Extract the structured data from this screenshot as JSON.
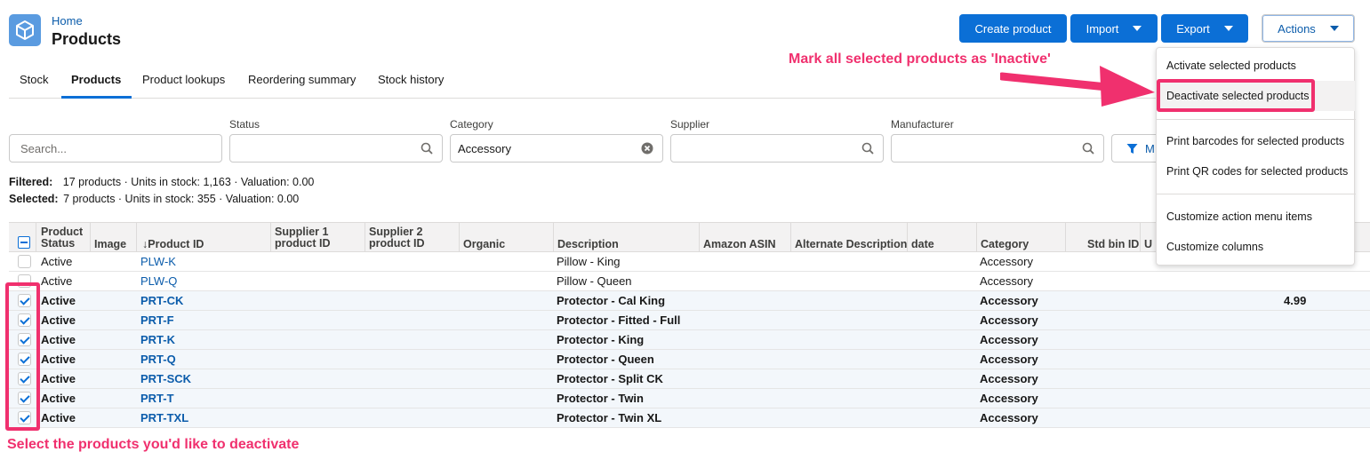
{
  "header": {
    "breadcrumb": "Home",
    "title": "Products",
    "buttons": {
      "create": "Create product",
      "import": "Import",
      "export": "Export",
      "actions": "Actions"
    }
  },
  "tabs": [
    "Stock",
    "Products",
    "Product lookups",
    "Reordering summary",
    "Stock history"
  ],
  "filters": {
    "search_placeholder": "Search...",
    "status_label": "Status",
    "category_label": "Category",
    "category_value": "Accessory",
    "supplier_label": "Supplier",
    "manufacturer_label": "Manufacturer",
    "more_filters_label": "M"
  },
  "summary": {
    "filtered_label": "Filtered:",
    "filtered_text": "17 products · Units in stock: 1,163 · Valuation: 0.00",
    "selected_label": "Selected:",
    "selected_text": "7 products · Units in stock: 355 · Valuation: 0.00"
  },
  "table": {
    "columns": {
      "status_l1": "Product",
      "status_l2": "Status",
      "image": "Image",
      "product_id": "↓Product ID",
      "supplier1_l1": "Supplier 1",
      "supplier1_l2": "product ID",
      "supplier2_l1": "Supplier 2",
      "supplier2_l2": "product ID",
      "organic": "Organic",
      "description": "Description",
      "asin": "Amazon ASIN",
      "alt_desc": "Alternate Description",
      "date": "date",
      "category": "Category",
      "std_bin": "Std bin ID",
      "extra": "U"
    },
    "rows": [
      {
        "status": "Active",
        "id": "PLW-K",
        "description": "Pillow - King",
        "category": "Accessory",
        "price": "",
        "selected": false
      },
      {
        "status": "Active",
        "id": "PLW-Q",
        "description": "Pillow - Queen",
        "category": "Accessory",
        "price": "",
        "selected": false
      },
      {
        "status": "Active",
        "id": "PRT-CK",
        "description": "Protector - Cal King",
        "category": "Accessory",
        "price": "4.99",
        "selected": true
      },
      {
        "status": "Active",
        "id": "PRT-F",
        "description": "Protector - Fitted - Full",
        "category": "Accessory",
        "price": "",
        "selected": true
      },
      {
        "status": "Active",
        "id": "PRT-K",
        "description": "Protector - King",
        "category": "Accessory",
        "price": "",
        "selected": true
      },
      {
        "status": "Active",
        "id": "PRT-Q",
        "description": "Protector - Queen",
        "category": "Accessory",
        "price": "",
        "selected": true
      },
      {
        "status": "Active",
        "id": "PRT-SCK",
        "description": "Protector - Split CK",
        "category": "Accessory",
        "price": "",
        "selected": true
      },
      {
        "status": "Active",
        "id": "PRT-T",
        "description": "Protector - Twin",
        "category": "Accessory",
        "price": "",
        "selected": true
      },
      {
        "status": "Active",
        "id": "PRT-TXL",
        "description": "Protector - Twin XL",
        "category": "Accessory",
        "price": "",
        "selected": true
      }
    ]
  },
  "actions_menu": {
    "items": [
      "Activate selected products",
      "Deactivate selected products",
      "Print barcodes for selected products",
      "Print QR codes for selected products",
      "Customize action menu items",
      "Customize columns"
    ]
  },
  "annotations": {
    "top": "Mark all selected products as 'Inactive'",
    "bottom": "Select the products you'd like to deactivate",
    "color": "#f0306e"
  }
}
